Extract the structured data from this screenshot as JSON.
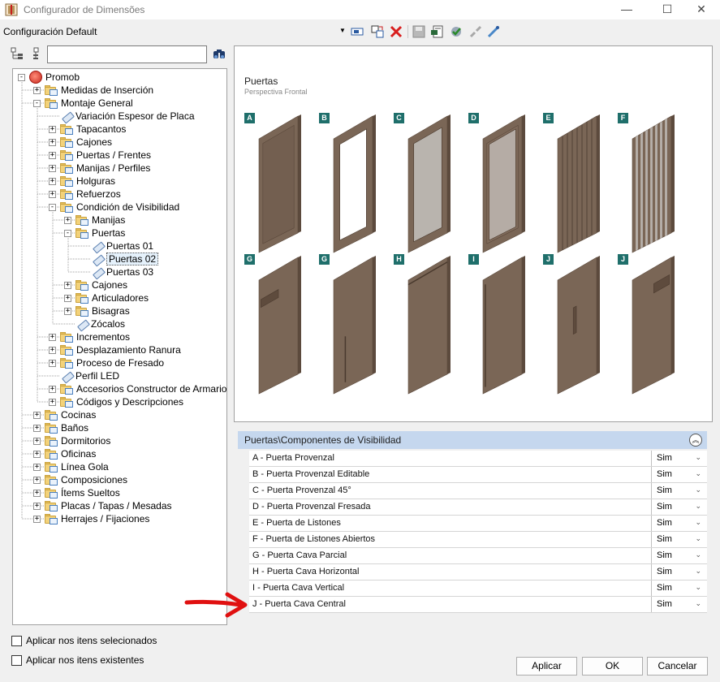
{
  "window": {
    "title": "Configurador de Dimensões",
    "minimize": "—",
    "maximize": "☐",
    "close": "✕"
  },
  "config": {
    "label": "Configuración Default"
  },
  "tree": {
    "items": [
      {
        "label": "Promob",
        "level": 0,
        "type": "root",
        "exp": "-"
      },
      {
        "label": "Medidas de Inserción",
        "level": 1,
        "type": "folder",
        "exp": "+"
      },
      {
        "label": "Montaje General",
        "level": 1,
        "type": "folder",
        "exp": "-"
      },
      {
        "label": "Variación Espesor de Placa",
        "level": 2,
        "type": "item",
        "exp": ""
      },
      {
        "label": "Tapacantos",
        "level": 2,
        "type": "folder",
        "exp": "+"
      },
      {
        "label": "Cajones",
        "level": 2,
        "type": "folder",
        "exp": "+"
      },
      {
        "label": "Puertas / Frentes",
        "level": 2,
        "type": "folder",
        "exp": "+"
      },
      {
        "label": "Manijas / Perfiles",
        "level": 2,
        "type": "folder",
        "exp": "+"
      },
      {
        "label": "Holguras",
        "level": 2,
        "type": "folder",
        "exp": "+"
      },
      {
        "label": "Refuerzos",
        "level": 2,
        "type": "folder",
        "exp": "+"
      },
      {
        "label": "Condición de Visibilidad",
        "level": 2,
        "type": "folder",
        "exp": "-"
      },
      {
        "label": "Manijas",
        "level": 3,
        "type": "folder",
        "exp": "+"
      },
      {
        "label": "Puertas",
        "level": 3,
        "type": "folder",
        "exp": "-"
      },
      {
        "label": "Puertas 01",
        "level": 4,
        "type": "item",
        "exp": ""
      },
      {
        "label": "Puertas 02",
        "level": 4,
        "type": "item",
        "exp": "",
        "selected": true
      },
      {
        "label": "Puertas 03",
        "level": 4,
        "type": "item",
        "exp": ""
      },
      {
        "label": "Cajones",
        "level": 3,
        "type": "folder",
        "exp": "+"
      },
      {
        "label": "Articuladores",
        "level": 3,
        "type": "folder",
        "exp": "+"
      },
      {
        "label": "Bisagras",
        "level": 3,
        "type": "folder",
        "exp": "+"
      },
      {
        "label": "Zócalos",
        "level": 3,
        "type": "item",
        "exp": ""
      },
      {
        "label": "Incrementos",
        "level": 2,
        "type": "folder",
        "exp": "+"
      },
      {
        "label": "Desplazamiento Ranura",
        "level": 2,
        "type": "folder",
        "exp": "+"
      },
      {
        "label": "Proceso de Fresado",
        "level": 2,
        "type": "folder",
        "exp": "+"
      },
      {
        "label": "Perfil LED",
        "level": 2,
        "type": "item",
        "exp": ""
      },
      {
        "label": "Accesorios Constructor de Armarios",
        "level": 2,
        "type": "folder",
        "exp": "+"
      },
      {
        "label": "Códigos y Descripciones",
        "level": 2,
        "type": "folder",
        "exp": "+"
      },
      {
        "label": "Cocinas",
        "level": 1,
        "type": "folder",
        "exp": "+"
      },
      {
        "label": "Baños",
        "level": 1,
        "type": "folder",
        "exp": "+"
      },
      {
        "label": "Dormitorios",
        "level": 1,
        "type": "folder",
        "exp": "+"
      },
      {
        "label": "Oficinas",
        "level": 1,
        "type": "folder",
        "exp": "+"
      },
      {
        "label": "Línea Gola",
        "level": 1,
        "type": "folder",
        "exp": "+"
      },
      {
        "label": "Composiciones",
        "level": 1,
        "type": "folder",
        "exp": "+"
      },
      {
        "label": "Ítems Sueltos",
        "level": 1,
        "type": "folder",
        "exp": "+"
      },
      {
        "label": "Placas / Tapas / Mesadas",
        "level": 1,
        "type": "folder",
        "exp": "+"
      },
      {
        "label": "Herrajes / Fijaciones",
        "level": 1,
        "type": "folder",
        "exp": "+"
      }
    ]
  },
  "preview": {
    "title": "Puertas",
    "subtitle": "Perspectiva Frontal",
    "doors": [
      {
        "badge": "A",
        "style": "provenzal"
      },
      {
        "badge": "B",
        "style": "glass-white"
      },
      {
        "badge": "C",
        "style": "glass-grey"
      },
      {
        "badge": "D",
        "style": "fresada"
      },
      {
        "badge": "E",
        "style": "listones"
      },
      {
        "badge": "F",
        "style": "listones-abiertos"
      },
      {
        "badge": "G",
        "style": "cava-parcial"
      },
      {
        "badge": "G",
        "style": "cava-parcial-2"
      },
      {
        "badge": "H",
        "style": "cava-horizontal"
      },
      {
        "badge": "I",
        "style": "cava-vertical"
      },
      {
        "badge": "J",
        "style": "cava-central"
      },
      {
        "badge": "J",
        "style": "cava-central-2"
      }
    ]
  },
  "properties": {
    "header": "Puertas\\Componentes de Visibilidad",
    "rows": [
      {
        "name": "A - Puerta Provenzal",
        "value": "Sim"
      },
      {
        "name": "B - Puerta Provenzal Editable",
        "value": "Sim"
      },
      {
        "name": "C - Puerta Provenzal 45°",
        "value": "Sim"
      },
      {
        "name": "D - Puerta Provenzal Fresada",
        "value": "Sim"
      },
      {
        "name": "E - Puerta de Listones",
        "value": "Sim"
      },
      {
        "name": "F - Puerta de Listones Abiertos",
        "value": "Sim"
      },
      {
        "name": "G - Puerta Cava Parcial",
        "value": "Sim"
      },
      {
        "name": "H - Puerta Cava Horizontal",
        "value": "Sim"
      },
      {
        "name": "I - Puerta Cava Vertical",
        "value": "Sim"
      },
      {
        "name": "J - Puerta Cava Central",
        "value": "Sim"
      }
    ]
  },
  "options": {
    "apply_selected": "Aplicar nos itens selecionados",
    "apply_existing": "Aplicar nos itens existentes"
  },
  "buttons": {
    "apply": "Aplicar",
    "ok": "OK",
    "cancel": "Cancelar"
  },
  "colors": {
    "wood": "#7a6656",
    "wood_dark": "#5c4a3d",
    "badge": "#1f6f6b",
    "header": "#c5d7ee",
    "arrow": "#e01010"
  }
}
